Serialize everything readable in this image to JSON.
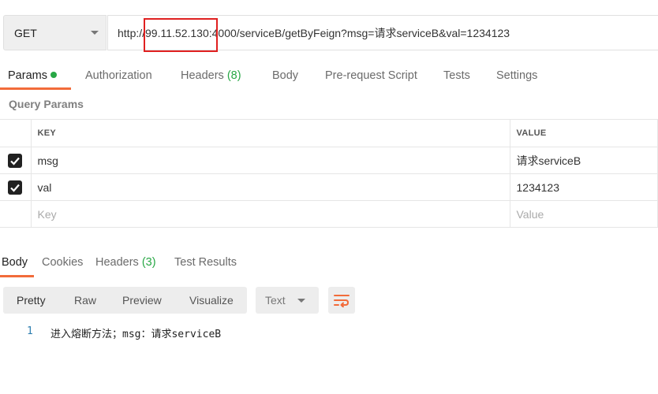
{
  "request": {
    "method": "GET",
    "url": "http://99.11.52.130:4000/serviceB/getByFeign?msg=请求serviceB&val=1234123"
  },
  "request_tabs": [
    {
      "label": "Params",
      "active": true
    },
    {
      "label": "Authorization"
    },
    {
      "label": "Headers",
      "count": "(8)"
    },
    {
      "label": "Body"
    },
    {
      "label": "Pre-request Script"
    },
    {
      "label": "Tests"
    },
    {
      "label": "Settings"
    }
  ],
  "query_params": {
    "title": "Query Params",
    "headers": {
      "key": "KEY",
      "value": "VALUE"
    },
    "rows": [
      {
        "key": "msg",
        "value": "请求serviceB",
        "checked": true
      },
      {
        "key": "val",
        "value": "1234123",
        "checked": true
      }
    ],
    "placeholder": {
      "key": "Key",
      "value": "Value"
    }
  },
  "response_tabs": [
    {
      "label": "Body",
      "active": true
    },
    {
      "label": "Cookies"
    },
    {
      "label": "Headers",
      "count": "(3)"
    },
    {
      "label": "Test Results"
    }
  ],
  "view_modes": [
    "Pretty",
    "Raw",
    "Preview",
    "Visualize"
  ],
  "format": "Text",
  "response_body": [
    {
      "line": "1",
      "text": "进入熔断方法；msg：请求serviceB"
    }
  ],
  "colors": {
    "accent": "#f26b3a",
    "count_green": "#28a745",
    "highlight_box": "#e02020"
  }
}
